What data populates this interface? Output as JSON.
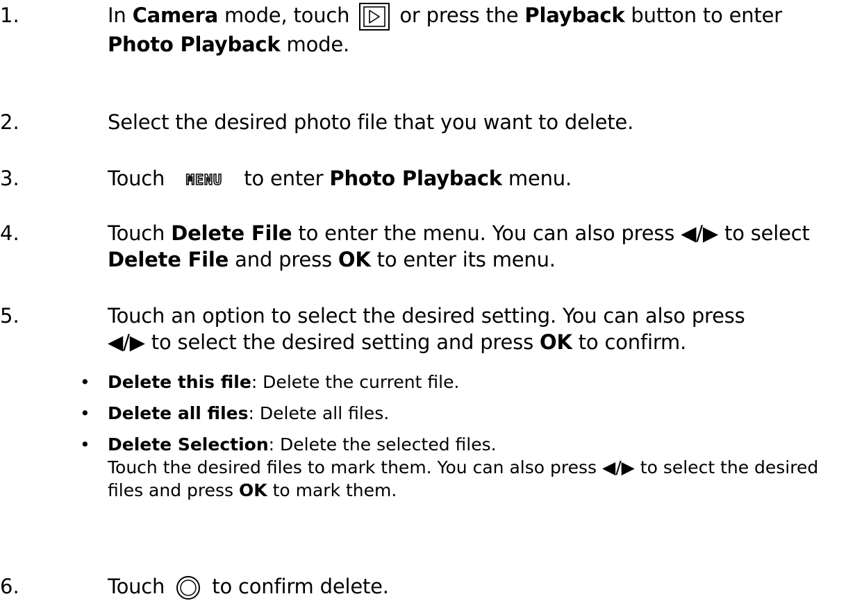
{
  "steps": [
    {
      "number": "1.",
      "parts": [
        "In ",
        "Camera",
        " mode, touch ",
        " or press the ",
        "Playback",
        " button to enter ",
        "Photo Playback",
        " mode."
      ],
      "icon": "playback-icon"
    },
    {
      "number": "2.",
      "text": "Select the desired photo file that you want to delete."
    },
    {
      "number": "3.",
      "parts": [
        "Touch ",
        " to enter ",
        "Photo Playback",
        " menu."
      ],
      "icon": "menu-icon",
      "icon_label": "MENU"
    },
    {
      "number": "4.",
      "parts": [
        "Touch ",
        "Delete File",
        " to enter the menu. You can also press ",
        " to select ",
        "Delete File",
        " and press ",
        "OK",
        " to enter its menu."
      ]
    },
    {
      "number": "5.",
      "parts": [
        "Touch an option to select the desired setting. You can also press ",
        " to select the desired setting and press ",
        "OK",
        " to confirm."
      ]
    },
    {
      "number": "6.",
      "parts": [
        "Touch ",
        " to confirm delete."
      ],
      "icon": "confirm-circle-icon"
    }
  ],
  "arrows_label": "◀/▶",
  "options": [
    {
      "label": "Delete this file",
      "desc": ": Delete the current file."
    },
    {
      "label": "Delete all files",
      "desc": ": Delete all files."
    },
    {
      "label": "Delete Selection",
      "desc": ": Delete the selected files.",
      "cont": [
        "Touch the desired files to mark them. You can also press ",
        " to select the desired files and press ",
        "OK",
        " to mark them."
      ]
    }
  ],
  "bullet_char": "•"
}
